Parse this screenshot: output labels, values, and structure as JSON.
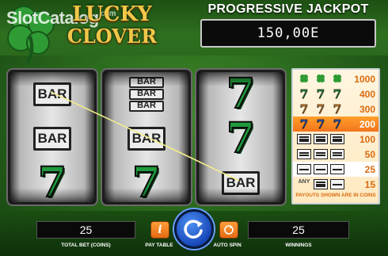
{
  "header": {
    "watermark": "SlotCatalog",
    "watermark_suffix": ".com",
    "title_line1": "LUCKY",
    "title_line2": "CLOVER",
    "jackpot_label": "PROGRESSIVE JACKPOT",
    "jackpot_value": "150,00E"
  },
  "reels": [
    [
      "bar-single",
      "bar-single",
      "seven"
    ],
    [
      "bar-triple",
      "bar-single",
      "seven"
    ],
    [
      "seven",
      "seven",
      "bar-single"
    ]
  ],
  "symbols": {
    "bar_text": "BAR",
    "seven_text": "7"
  },
  "paytable": {
    "rows": [
      {
        "symbols": "clover x3",
        "payout": "1000"
      },
      {
        "symbols": "green seven x3",
        "payout": "400"
      },
      {
        "symbols": "orange seven x3",
        "payout": "300"
      },
      {
        "symbols": "blue seven x3",
        "payout": "200"
      },
      {
        "symbols": "triple bar x3",
        "payout": "100"
      },
      {
        "symbols": "double bar x3",
        "payout": "50"
      },
      {
        "symbols": "single bar x3",
        "payout": "25"
      },
      {
        "symbols": "any bar x3",
        "payout": "15"
      }
    ],
    "any_label": "ANY",
    "note": "PAYOUTS SHOWN ARE IN COINS"
  },
  "controls": {
    "total_bet_value": "25",
    "total_bet_label": "TOTAL BET (COINS)",
    "paytable_icon": "i",
    "paytable_label": "PAY TABLE",
    "spin_icon": "spin-icon",
    "autospin_label": "AUTO SPIN",
    "winnings_value": "25",
    "winnings_label": "WINNINGS"
  },
  "colors": {
    "felt_green": "#2b6a1d",
    "gold_title": "#f0c84a",
    "seven_green": "#1f9a3c",
    "seven_orange": "#f08a1c",
    "seven_blue": "#2a63d8",
    "paytable_orange": "#f3741d",
    "spin_blue": "#1847b8",
    "win_line": "#f2ec8a"
  }
}
